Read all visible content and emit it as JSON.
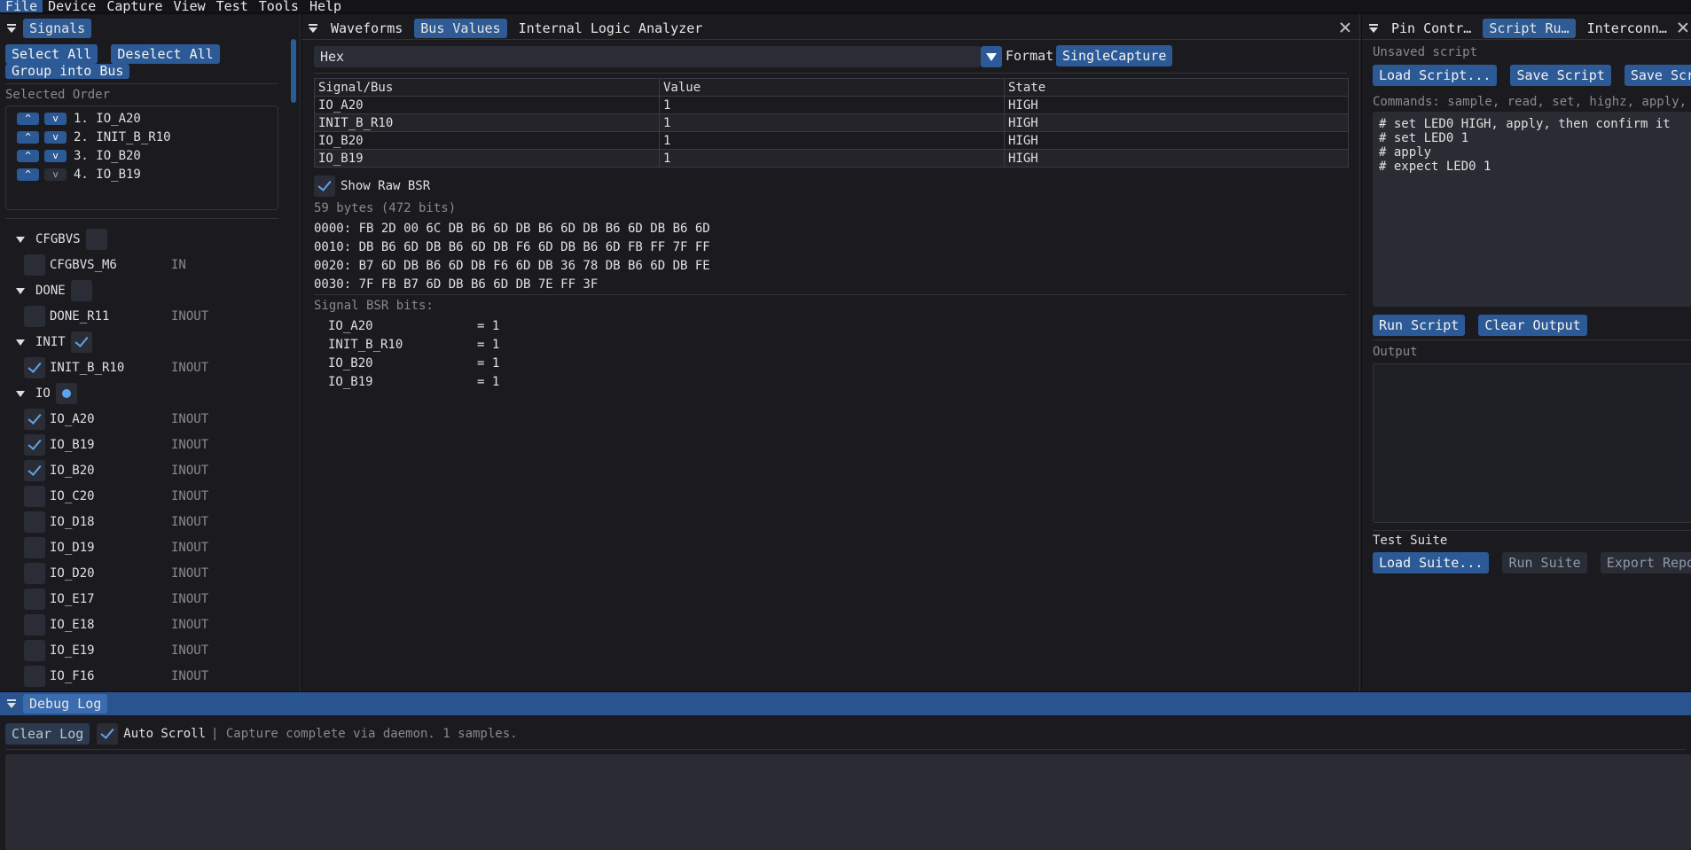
{
  "menu": [
    "File",
    "Device",
    "Capture",
    "View",
    "Test",
    "Tools",
    "Help"
  ],
  "left": {
    "tab": "Signals",
    "select_all": "Select All",
    "deselect_all": "Deselect All",
    "group_bus": "Group into Bus",
    "selected_order_label": "Selected Order",
    "order": [
      "1. IO_A20",
      "2. INIT_B_R10",
      "3. IO_B20",
      "4. IO_B19"
    ],
    "up": "^",
    "down": "v",
    "groups": [
      {
        "name": "CFGBVS",
        "state": "off",
        "signals": [
          {
            "name": "CFGBVS_M6",
            "dir": "IN",
            "checked": false
          }
        ]
      },
      {
        "name": "DONE",
        "state": "off",
        "signals": [
          {
            "name": "DONE_R11",
            "dir": "INOUT",
            "checked": false
          }
        ]
      },
      {
        "name": "INIT",
        "state": "on",
        "signals": [
          {
            "name": "INIT_B_R10",
            "dir": "INOUT",
            "checked": true
          }
        ]
      },
      {
        "name": "IO",
        "state": "partial",
        "signals": [
          {
            "name": "IO_A20",
            "dir": "INOUT",
            "checked": true
          },
          {
            "name": "IO_B19",
            "dir": "INOUT",
            "checked": true
          },
          {
            "name": "IO_B20",
            "dir": "INOUT",
            "checked": true
          },
          {
            "name": "IO_C20",
            "dir": "INOUT",
            "checked": false
          },
          {
            "name": "IO_D18",
            "dir": "INOUT",
            "checked": false
          },
          {
            "name": "IO_D19",
            "dir": "INOUT",
            "checked": false
          },
          {
            "name": "IO_D20",
            "dir": "INOUT",
            "checked": false
          },
          {
            "name": "IO_E17",
            "dir": "INOUT",
            "checked": false
          },
          {
            "name": "IO_E18",
            "dir": "INOUT",
            "checked": false
          },
          {
            "name": "IO_E19",
            "dir": "INOUT",
            "checked": false
          },
          {
            "name": "IO_F16",
            "dir": "INOUT",
            "checked": false
          }
        ]
      }
    ]
  },
  "center": {
    "tabs": [
      "Waveforms",
      "Bus Values",
      "Internal Logic Analyzer"
    ],
    "active_tab": "Bus Values",
    "format_value": "Hex",
    "format_label": "Format",
    "capture_mode": "SingleCapture",
    "table_headers": [
      "Signal/Bus",
      "Value",
      "State"
    ],
    "table_rows": [
      [
        "IO_A20",
        "1",
        "HIGH"
      ],
      [
        "INIT_B_R10",
        "1",
        "HIGH"
      ],
      [
        "IO_B20",
        "1",
        "HIGH"
      ],
      [
        "IO_B19",
        "1",
        "HIGH"
      ]
    ],
    "show_raw_label": "Show Raw BSR",
    "bytes_info": "59 bytes (472 bits)",
    "hex_lines": [
      "0000: FB 2D 00 6C DB B6 6D DB B6 6D DB B6 6D DB B6 6D",
      "0010: DB B6 6D DB B6 6D DB F6 6D DB B6 6D FB FF 7F FF",
      "0020: B7 6D DB B6 6D DB F6 6D DB 36 78 DB B6 6D DB FE",
      "0030: 7F FB B7 6D DB B6 6D DB 7E FF 3F"
    ],
    "bsr_label": "Signal BSR bits:",
    "bsr_bits": [
      {
        "name": "IO_A20",
        "value": "= 1"
      },
      {
        "name": "INIT_B_R10",
        "value": "= 1"
      },
      {
        "name": "IO_B20",
        "value": "= 1"
      },
      {
        "name": "IO_B19",
        "value": "= 1"
      }
    ]
  },
  "right": {
    "tabs": [
      "Pin Contr…",
      "Script Ru…",
      "Interconn…"
    ],
    "active_tab": "Script Ru…",
    "unsaved": "Unsaved script",
    "load_script": "Load Script...",
    "save_script": "Save Script",
    "save_script_as": "Save Script A",
    "commands_hint": "Commands: sample, read, set, highz, apply, ex",
    "script_lines": [
      "# set LED0 HIGH, apply, then confirm it",
      "# set LED0 1",
      "# apply",
      "# expect LED0 1"
    ],
    "run_script": "Run Script",
    "clear_output": "Clear Output",
    "output_label": "Output",
    "test_suite_label": "Test Suite",
    "load_suite": "Load Suite...",
    "run_suite": "Run Suite",
    "export_report": "Export Report..."
  },
  "bottom": {
    "tab": "Debug Log",
    "clear_log": "Clear Log",
    "auto_scroll": "Auto Scroll",
    "status": "| Capture complete via daemon. 1 samples."
  }
}
